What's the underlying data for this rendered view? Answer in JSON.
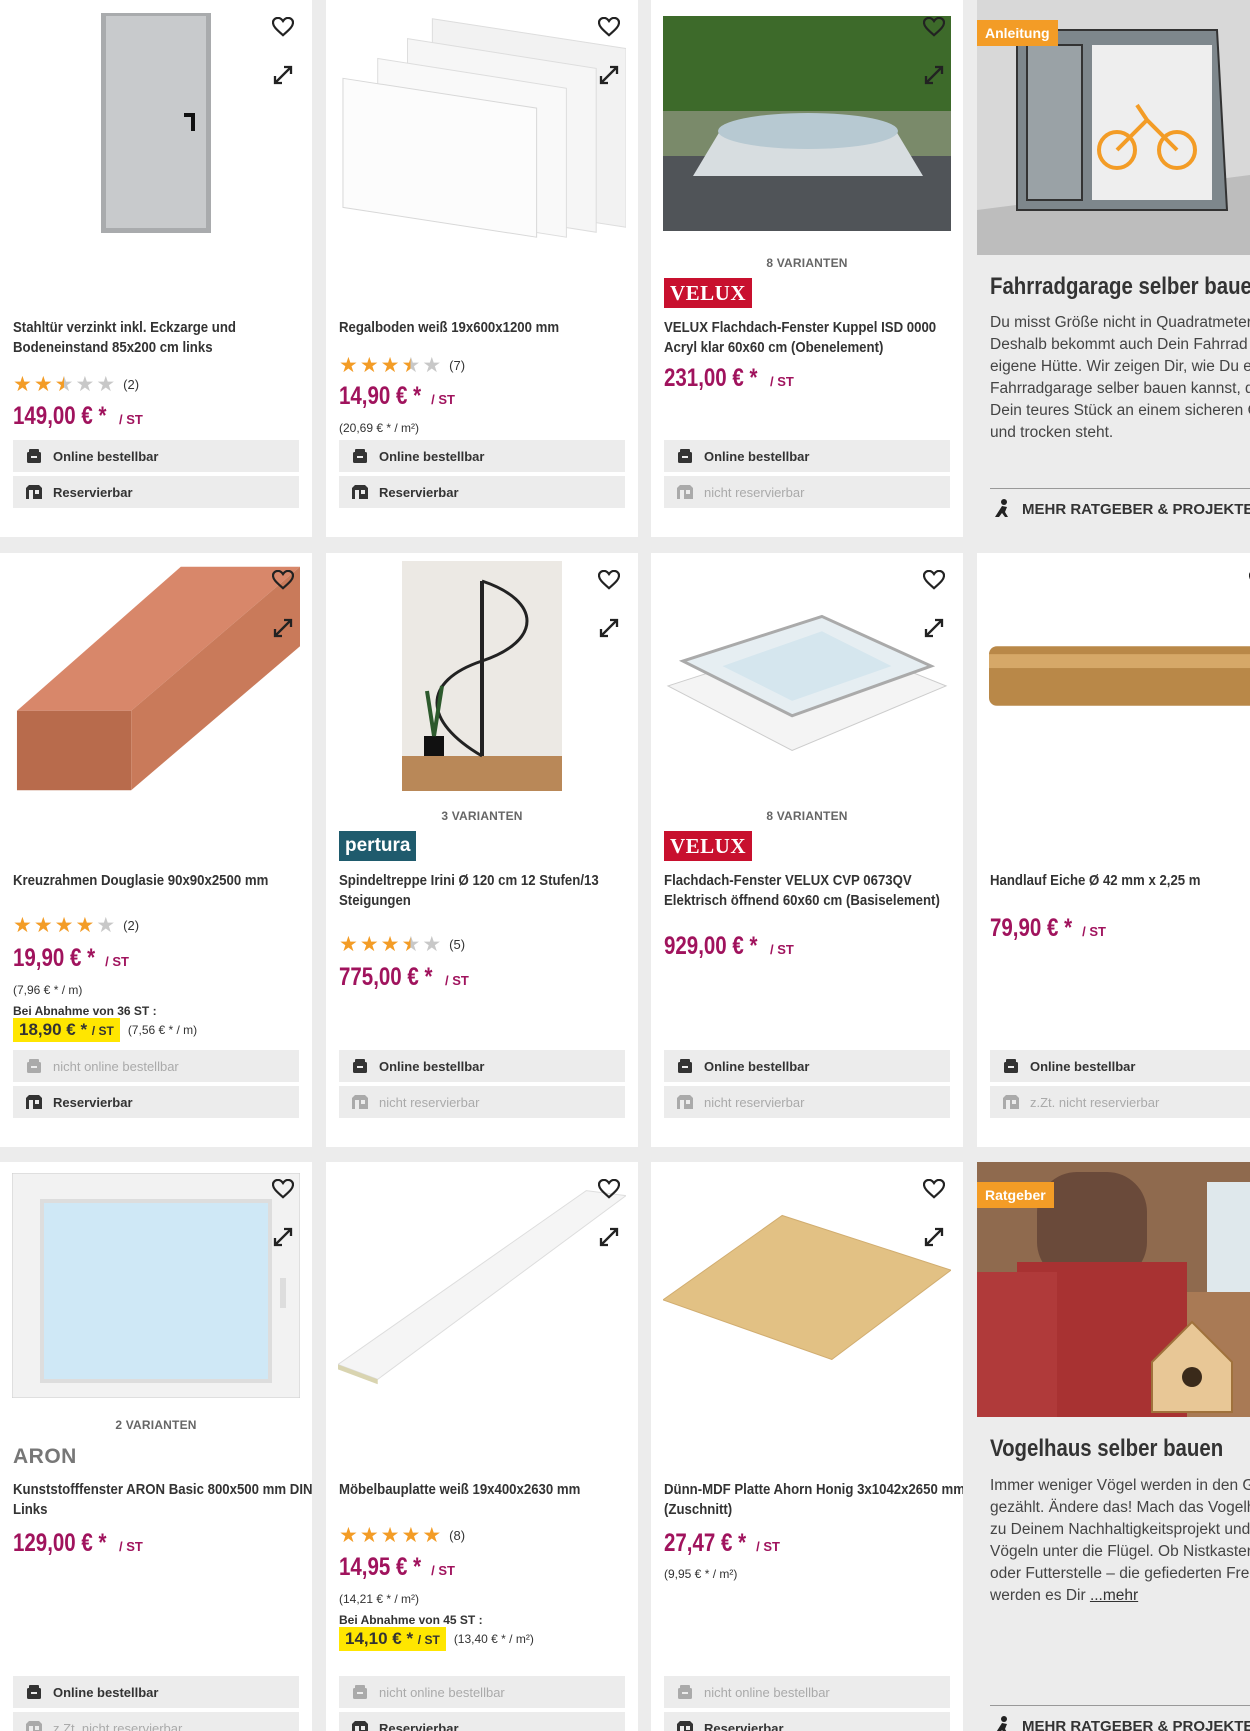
{
  "products": [
    {
      "title": "Stahltür verzinkt inkl. Eckzarge und Bodeneinstand 85x200 cm links",
      "rating_count": "(2)",
      "stars": [
        1,
        1,
        0.5,
        0,
        0
      ],
      "price": "149,00 € *",
      "unit": "/ ST",
      "online": "Online bestellbar",
      "reserve": "Reservierbar"
    },
    {
      "title": "Regalboden weiß 19x600x1200 mm",
      "rating_count": "(7)",
      "stars": [
        1,
        1,
        1,
        0.5,
        0
      ],
      "price": "14,90 € *",
      "unit": "/ ST",
      "unit_price": "(20,69 € * / m²)",
      "online": "Online bestellbar",
      "reserve": "Reservierbar"
    },
    {
      "variants": "8 VARIANTEN",
      "brand": "VELUX",
      "title": "VELUX Flachdach-Fenster Kuppel ISD 0000 Acryl klar 60x60 cm (Obenelement)",
      "price": "231,00 € *",
      "unit": "/ ST",
      "online": "Online bestellbar",
      "reserve": "nicht reservierbar"
    },
    {
      "title": "Kreuzrahmen Douglasie 90x90x2500 mm",
      "rating_count": "(2)",
      "stars": [
        1,
        1,
        1,
        1,
        0
      ],
      "price": "19,90 € *",
      "unit": "/ ST",
      "unit_price": "(7,96 € * / m)",
      "bulk_label": "Bei Abnahme von 36 ST :",
      "bulk_price": "18,90 € *",
      "bulk_unit": "/ ST",
      "bulk_unit_price": "(7,56 € * / m)",
      "online": "nicht online bestellbar",
      "reserve": "Reservierbar"
    },
    {
      "variants": "3 VARIANTEN",
      "brand": "pertura",
      "title": "Spindeltreppe Irini Ø 120 cm 12 Stufen/13 Steigungen",
      "rating_count": "(5)",
      "stars": [
        1,
        1,
        1,
        0.5,
        0
      ],
      "price": "775,00 € *",
      "unit": "/ ST",
      "online": "Online bestellbar",
      "reserve": "nicht reservierbar"
    },
    {
      "variants": "8 VARIANTEN",
      "brand": "VELUX",
      "title": "Flachdach-Fenster VELUX CVP 0673QV Elektrisch öffnend 60x60 cm (Basiselement)",
      "price": "929,00 € *",
      "unit": "/ ST",
      "online": "Online bestellbar",
      "reserve": "nicht reservierbar"
    },
    {
      "title": "Handlauf Eiche Ø 42 mm x 2,25 m",
      "price": "79,90 € *",
      "unit": "/ ST",
      "online": "Online bestellbar",
      "reserve": "z.Zt. nicht reservierbar"
    },
    {
      "variants": "2 VARIANTEN",
      "brand": "ARON",
      "title": "Kunststofffenster ARON Basic 800x500 mm DIN Links",
      "price": "129,00 € *",
      "unit": "/ ST",
      "online": "Online bestellbar",
      "reserve": "z.Zt. nicht reservierbar"
    },
    {
      "title": "Möbelbauplatte weiß 19x400x2630 mm",
      "rating_count": "(8)",
      "stars": [
        1,
        1,
        1,
        1,
        1
      ],
      "price": "14,95 € *",
      "unit": "/ ST",
      "unit_price": "(14,21 € * / m²)",
      "bulk_label": "Bei Abnahme von 45 ST :",
      "bulk_price": "14,10 € *",
      "bulk_unit": "/ ST",
      "bulk_unit_price": "(13,40 € * / m²)",
      "online": "nicht online bestellbar",
      "reserve": "Reservierbar"
    },
    {
      "title": "Dünn-MDF Platte Ahorn Honig 3x1042x2650 mm (Zuschnitt)",
      "price": "27,47 € *",
      "unit": "/ ST",
      "unit_price": "(9,95 € * / m²)",
      "online": "nicht online bestellbar",
      "reserve": "Reservierbar"
    }
  ],
  "articles": [
    {
      "tag": "Anleitung",
      "title": "Fahrradgarage selber bauen",
      "text": "Du misst Größe nicht in Quadratmetern? Deshalb bekommt auch Dein Fahrrad eine eigene Hütte. Wir zeigen Dir, wie Du eine Fahrradgarage selber bauen kannst, damit Dein teures Stück an einem sicheren Ort und trocken steht.",
      "more": "MEHR RATGEBER & PROJEKTE"
    },
    {
      "tag": "Ratgeber",
      "title": "Vogelhaus selber bauen",
      "text": "Immer weniger Vögel werden in den Gärten gezählt. Ändere das! Mach das Vogelhaus zu Deinem Nachhaltigkeitsprojekt und greif Vögeln unter die Flügel. Ob Nistkasten oder Futterstelle – die gefiederten Freunde werden es Dir",
      "link": "...mehr",
      "more": "MEHR RATGEBER & PROJEKTE"
    }
  ],
  "colors": {
    "price": "#a0135d",
    "star": "#f39c26",
    "tag": "#f39c26",
    "highlight": "#ffe600",
    "velux": "#c8102e"
  }
}
